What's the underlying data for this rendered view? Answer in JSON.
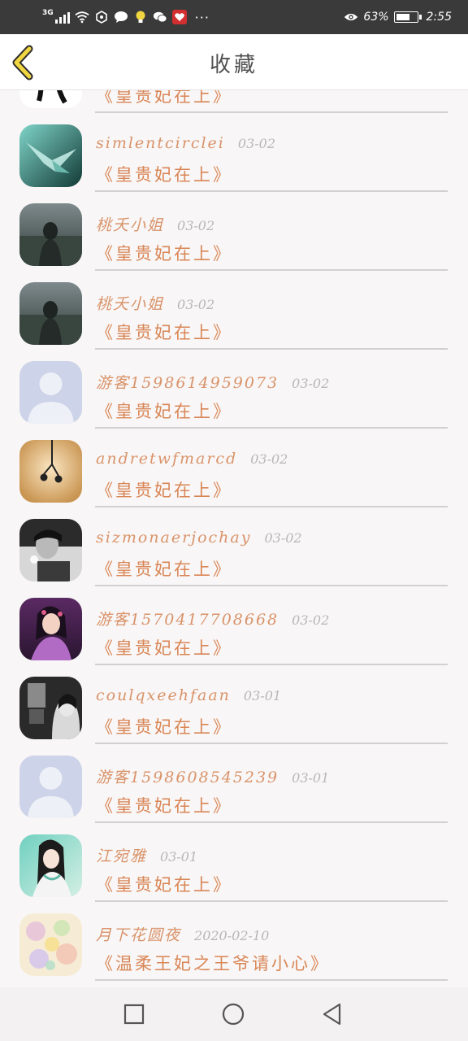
{
  "status_bar": {
    "network": "3G",
    "battery_percent": "63%",
    "battery_level": 0.63,
    "time": "2:55",
    "icons": [
      "signal-icon",
      "wifi-icon",
      "hexagon-icon",
      "chat-bubble-icon",
      "lightbulb-icon",
      "wechat-icon",
      "app-badge-icon",
      "more-dots-icon",
      "eye-icon",
      "battery-icon"
    ]
  },
  "header": {
    "title": "收藏",
    "back_icon": "back-chevron-icon"
  },
  "colors": {
    "name": "#d9936a",
    "book": "#d98656",
    "date": "#b9b6b6",
    "accent": "#f0d640"
  },
  "items": [
    {
      "name": "",
      "date": "",
      "book": "《皇贵妃在上》",
      "avatar": "drawing-icon"
    },
    {
      "name": "simlentcirclei",
      "date": "03-02",
      "book": "《皇贵妃在上》",
      "avatar": "paper-crane-icon"
    },
    {
      "name": "桃夭小姐",
      "date": "03-02",
      "book": "《皇贵妃在上》",
      "avatar": "girl-field-icon"
    },
    {
      "name": "桃夭小姐",
      "date": "03-02",
      "book": "《皇贵妃在上》",
      "avatar": "girl-field-icon"
    },
    {
      "name": "游客1598614959073",
      "date": "03-02",
      "book": "《皇贵妃在上》",
      "avatar": "default-user-icon"
    },
    {
      "name": "andretwfmarcd",
      "date": "03-02",
      "book": "《皇贵妃在上》",
      "avatar": "earphones-icon"
    },
    {
      "name": "sizmonaerjochay",
      "date": "03-02",
      "book": "《皇贵妃在上》",
      "avatar": "boy-portrait-icon"
    },
    {
      "name": "游客1570417708668",
      "date": "03-02",
      "book": "《皇贵妃在上》",
      "avatar": "fairy-girl-icon"
    },
    {
      "name": "coulqxeehfaan",
      "date": "03-01",
      "book": "《皇贵妃在上》",
      "avatar": "dark-portrait-icon"
    },
    {
      "name": "游客1598608545239",
      "date": "03-01",
      "book": "《皇贵妃在上》",
      "avatar": "default-user-icon"
    },
    {
      "name": "江宛雅",
      "date": "03-01",
      "book": "《皇贵妃在上》",
      "avatar": "ancient-girl-icon"
    },
    {
      "name": "月下花圆夜",
      "date": "2020-02-10",
      "book": "《温柔王妃之王爷请小心》",
      "avatar": "flower-collage-icon"
    }
  ],
  "nav": {
    "recent": "square-icon",
    "home": "circle-icon",
    "back": "triangle-back-icon"
  }
}
